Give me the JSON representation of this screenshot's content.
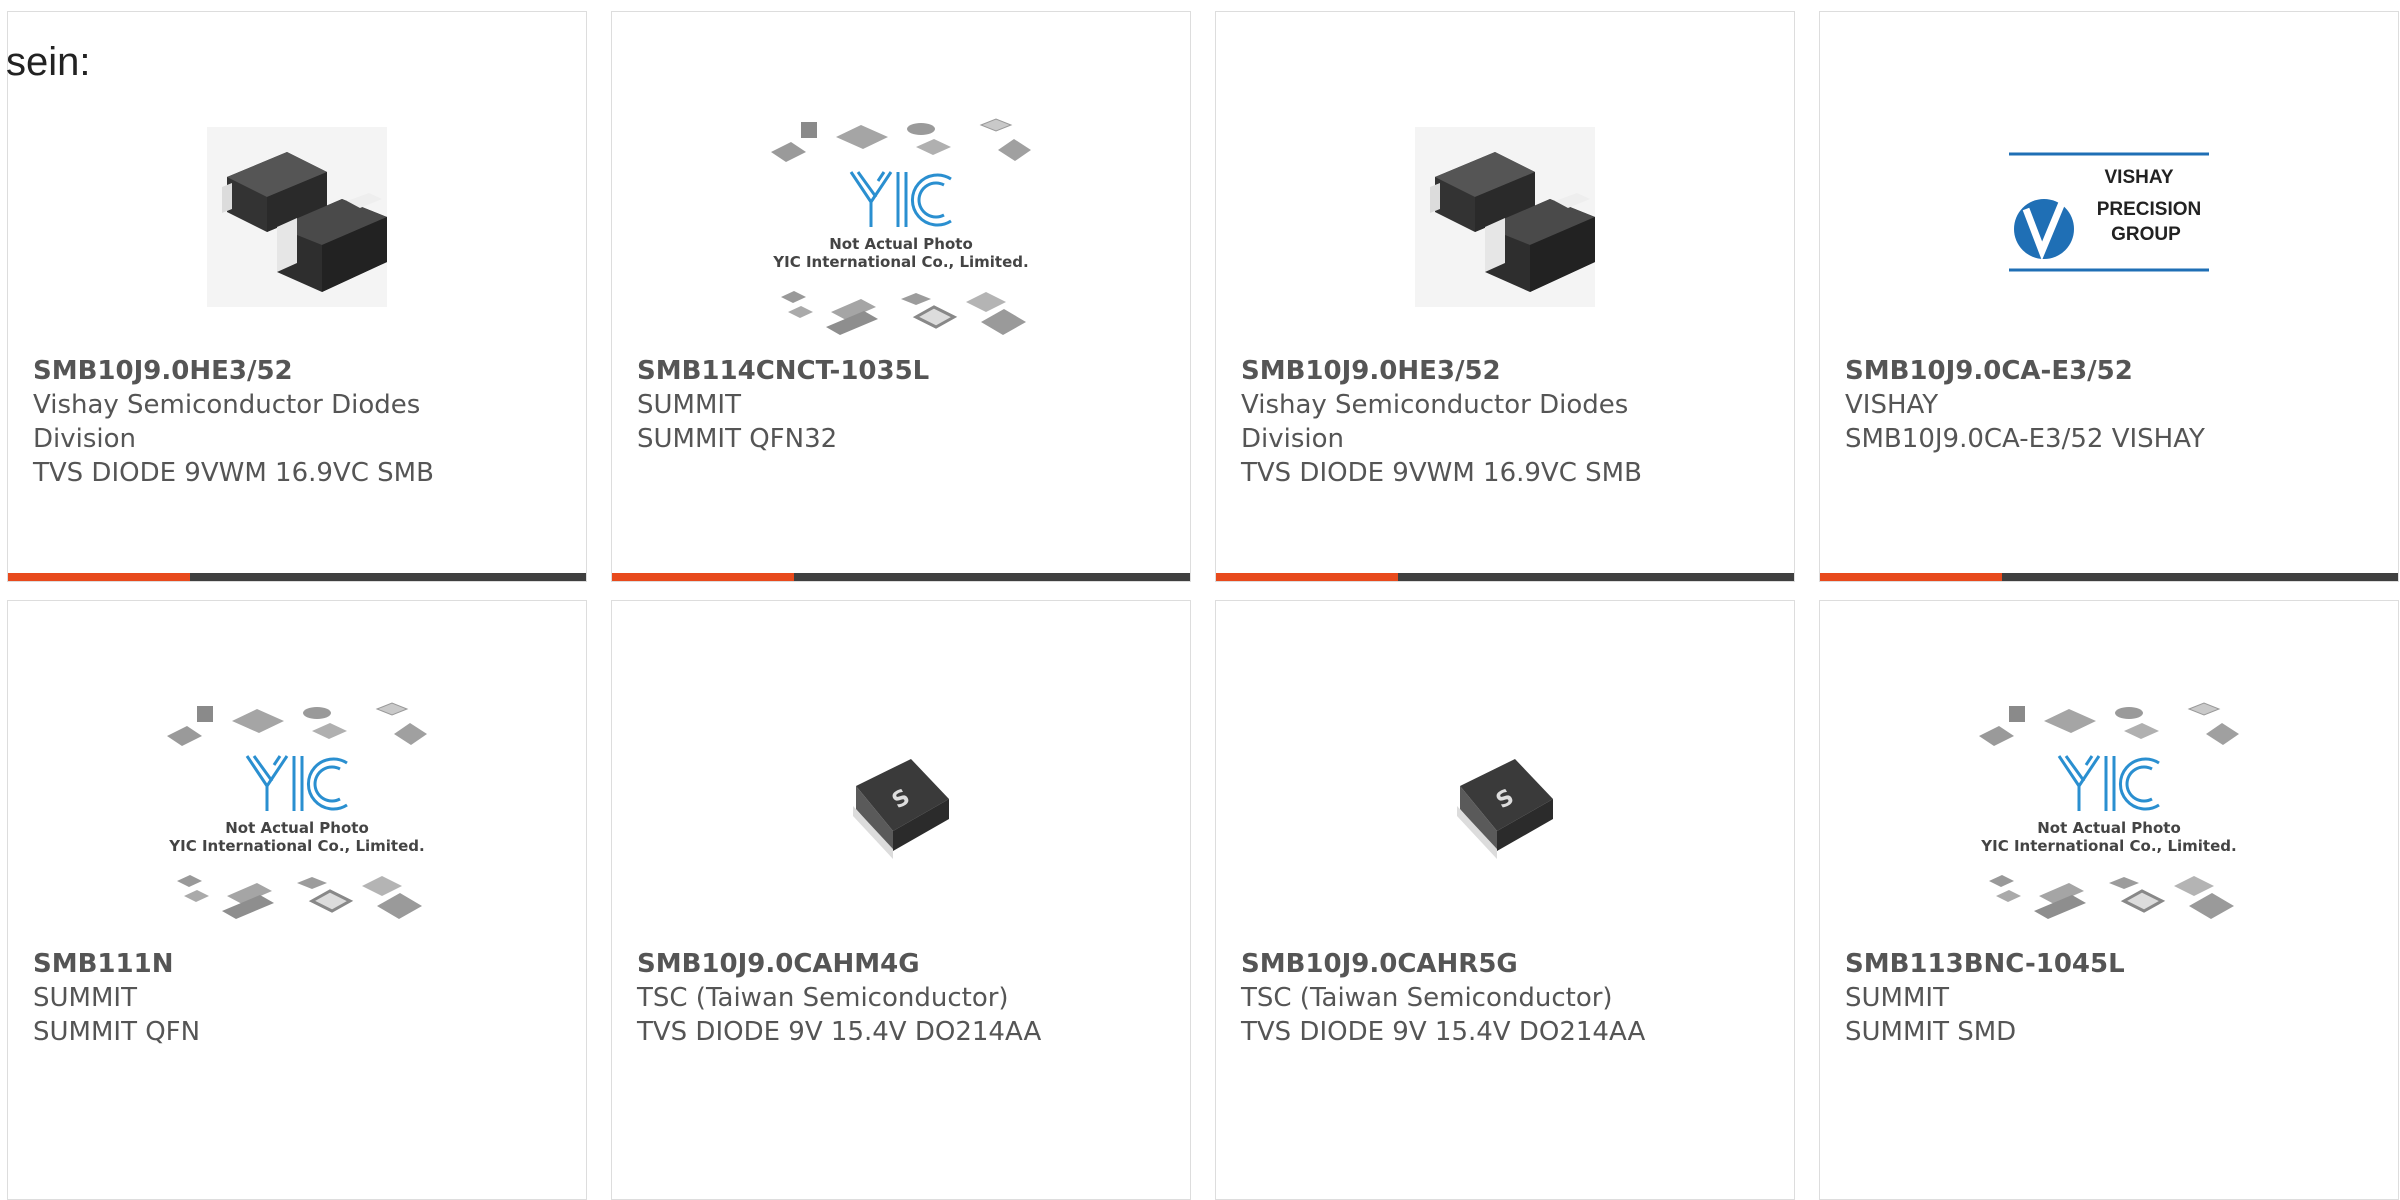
{
  "lead_text": "sein:",
  "placeholder_image": {
    "caption_line1": "Not Actual Photo",
    "caption_line2": "YIC International Co., Limited."
  },
  "vishay_logo": {
    "line1": "VISHAY",
    "line2": "PRECISION",
    "line3": "GROUP"
  },
  "products": [
    {
      "part_no": "SMB10J9.0HE3/52",
      "manufacturer_line1": "Vishay Semiconductor Diodes",
      "manufacturer_line2": "Division",
      "description": "TVS DIODE 9VWM 16.9VC SMB",
      "image": "smb-diode-photo"
    },
    {
      "part_no": "SMB114CNCT-1035L",
      "manufacturer_line1": "SUMMIT",
      "manufacturer_line2": "",
      "description": "SUMMIT QFN32",
      "image": "yic-placeholder"
    },
    {
      "part_no": "SMB10J9.0HE3/52",
      "manufacturer_line1": "Vishay Semiconductor Diodes",
      "manufacturer_line2": "Division",
      "description": "TVS DIODE 9VWM 16.9VC SMB",
      "image": "smb-diode-photo"
    },
    {
      "part_no": "SMB10J9.0CA-E3/52",
      "manufacturer_line1": "VISHAY",
      "manufacturer_line2": "",
      "description": "SMB10J9.0CA-E3/52 VISHAY",
      "image": "vishay-logo"
    },
    {
      "part_no": "SMB111N",
      "manufacturer_line1": "SUMMIT",
      "manufacturer_line2": "",
      "description": "SUMMIT QFN",
      "image": "yic-placeholder"
    },
    {
      "part_no": "SMB10J9.0CAHM4G",
      "manufacturer_line1": "TSC (Taiwan Semiconductor)",
      "manufacturer_line2": "",
      "description": "TVS DIODE 9V 15.4V DO214AA",
      "image": "do214-diode-photo"
    },
    {
      "part_no": "SMB10J9.0CAHR5G",
      "manufacturer_line1": "TSC (Taiwan Semiconductor)",
      "manufacturer_line2": "",
      "description": "TVS DIODE 9V 15.4V DO214AA",
      "image": "do214-diode-photo"
    },
    {
      "part_no": "SMB113BNC-1045L",
      "manufacturer_line1": "SUMMIT",
      "manufacturer_line2": "",
      "description": "SUMMIT SMD",
      "image": "yic-placeholder"
    }
  ],
  "colors": {
    "accent_bar": "#e84a1c",
    "dark_bar": "#3f3f3f",
    "card_border": "#dddddd",
    "text": "#555555",
    "yic_logo_blue": "#2a8fd0",
    "vishay_blue": "#1f6fb5"
  }
}
